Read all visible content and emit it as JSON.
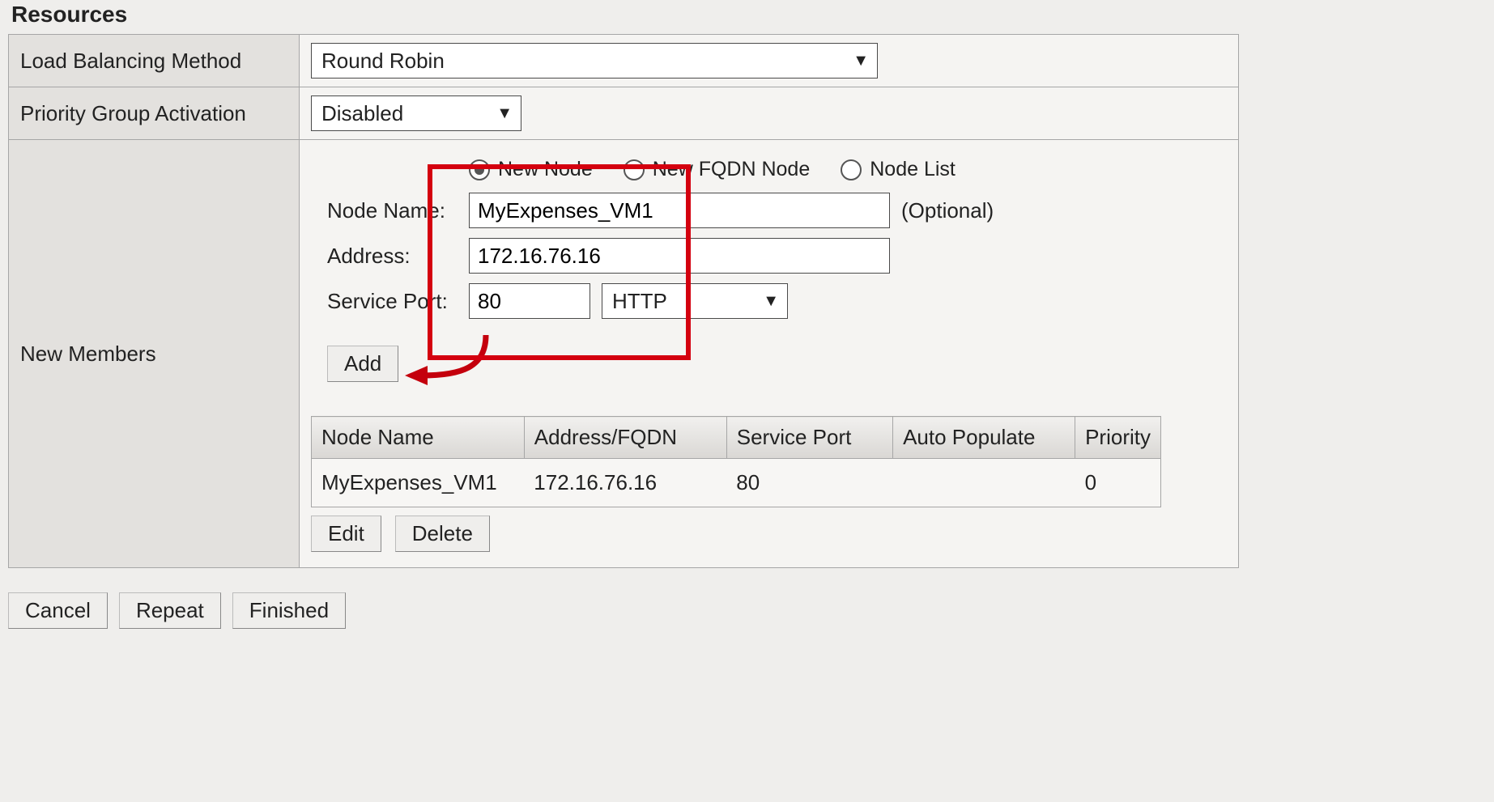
{
  "section_title": "Resources",
  "rows": {
    "lb_method_label": "Load Balancing Method",
    "lb_method_value": "Round Robin",
    "priority_label": "Priority Group Activation",
    "priority_value": "Disabled",
    "new_members_label": "New Members"
  },
  "radios": {
    "new_node": "New Node",
    "new_fqdn": "New FQDN Node",
    "node_list": "Node List"
  },
  "form": {
    "node_name_label": "Node Name:",
    "node_name_value": "MyExpenses_VM1",
    "node_name_hint": "(Optional)",
    "address_label": "Address:",
    "address_value": "172.16.76.16",
    "port_label": "Service Port:",
    "port_value": "80",
    "port_proto": "HTTP"
  },
  "buttons": {
    "add": "Add",
    "edit": "Edit",
    "delete": "Delete",
    "cancel": "Cancel",
    "repeat": "Repeat",
    "finished": "Finished"
  },
  "members_table": {
    "headers": {
      "node_name": "Node Name",
      "address": "Address/FQDN",
      "port": "Service Port",
      "auto": "Auto Populate",
      "priority": "Priority"
    },
    "rows": [
      {
        "node_name": "MyExpenses_VM1",
        "address": "172.16.76.16",
        "port": "80",
        "auto": "",
        "priority": "0"
      }
    ]
  }
}
